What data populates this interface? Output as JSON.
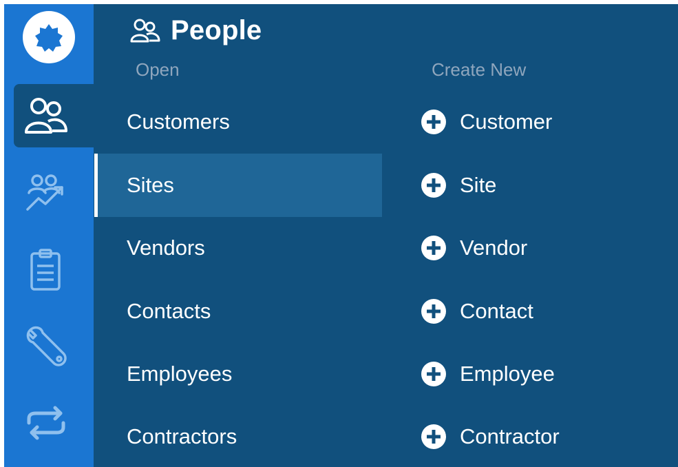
{
  "nav": {
    "logo_icon": "gear-logo-icon",
    "items": [
      {
        "icon": "people-icon",
        "active": true
      },
      {
        "icon": "people-chart-icon",
        "active": false
      },
      {
        "icon": "clipboard-icon",
        "active": false
      },
      {
        "icon": "wrench-icon",
        "active": false
      },
      {
        "icon": "sync-icon",
        "active": false
      }
    ]
  },
  "panel": {
    "title": "People",
    "title_icon": "people-icon"
  },
  "open": {
    "heading": "Open",
    "items": [
      "Customers",
      "Sites",
      "Vendors",
      "Contacts",
      "Employees",
      "Contractors"
    ],
    "selected": "Sites"
  },
  "create_new": {
    "heading": "Create New",
    "items": [
      "Customer",
      "Site",
      "Vendor",
      "Contact",
      "Employee",
      "Contractor"
    ]
  },
  "colors": {
    "panel_bg": "#11507d",
    "rail_bg": "#1b76d2",
    "selected_bg": "#1f6697",
    "heading_text": "#8fa6bd"
  }
}
